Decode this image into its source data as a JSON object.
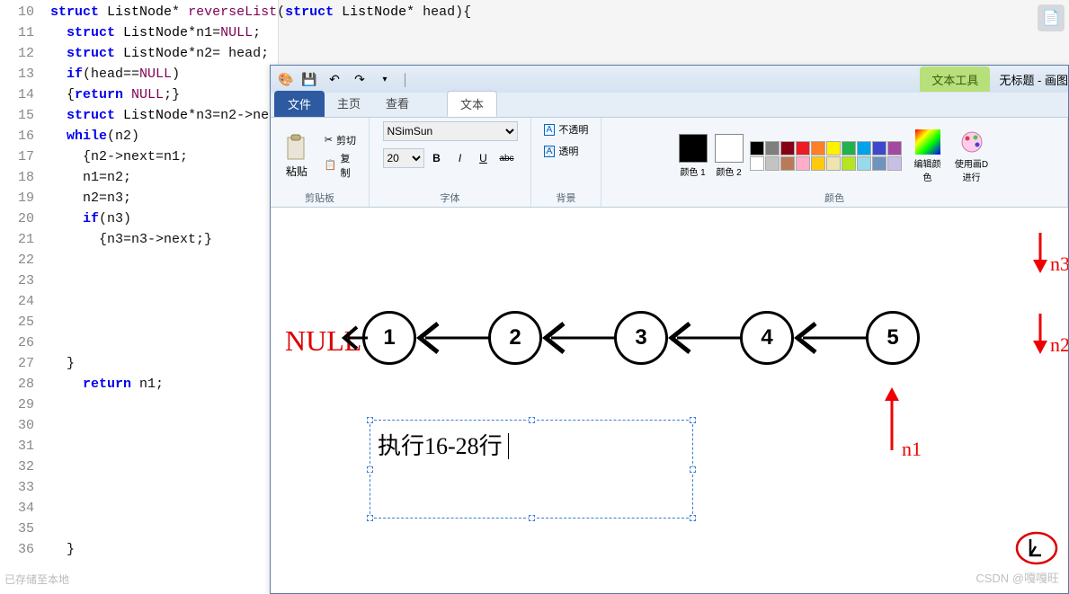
{
  "code": {
    "line_start": 10,
    "lines": [
      {
        "n": 10,
        "raw": "struct ListNode* reverseList(struct ListNode* head){"
      },
      {
        "n": 11,
        "raw": "  struct ListNode*n1=NULL;"
      },
      {
        "n": 12,
        "raw": "  struct ListNode*n2= head;"
      },
      {
        "n": 13,
        "raw": "  if(head==NULL)"
      },
      {
        "n": 14,
        "raw": "  {return NULL;}"
      },
      {
        "n": 15,
        "raw": "  struct ListNode*n3=n2->ne"
      },
      {
        "n": 16,
        "raw": "  while(n2)"
      },
      {
        "n": 17,
        "raw": "    {n2->next=n1;"
      },
      {
        "n": 18,
        "raw": "    n1=n2;"
      },
      {
        "n": 19,
        "raw": "    n2=n3;"
      },
      {
        "n": 20,
        "raw": "    if(n3)"
      },
      {
        "n": 21,
        "raw": "      {n3=n3->next;}"
      },
      {
        "n": 22,
        "raw": ""
      },
      {
        "n": 23,
        "raw": ""
      },
      {
        "n": 24,
        "raw": ""
      },
      {
        "n": 25,
        "raw": ""
      },
      {
        "n": 26,
        "raw": ""
      },
      {
        "n": 27,
        "raw": "  }"
      },
      {
        "n": 28,
        "raw": "    return n1;"
      },
      {
        "n": 29,
        "raw": ""
      },
      {
        "n": 30,
        "raw": ""
      },
      {
        "n": 31,
        "raw": ""
      },
      {
        "n": 32,
        "raw": ""
      },
      {
        "n": 33,
        "raw": ""
      },
      {
        "n": 34,
        "raw": ""
      },
      {
        "n": 35,
        "raw": ""
      },
      {
        "n": 36,
        "raw": "  }"
      }
    ],
    "status_text": "已存储至本地"
  },
  "paint": {
    "title": "无标题 - 画图",
    "context_tab": "文本工具",
    "tabs": {
      "file": "文件",
      "home": "主页",
      "view": "查看",
      "text": "文本"
    },
    "clipboard": {
      "label": "剪贴板",
      "paste": "粘贴",
      "cut": "剪切",
      "copy": "复制"
    },
    "font": {
      "label": "字体",
      "family": "NSimSun",
      "size": "20",
      "bold": "B",
      "italic": "I",
      "underline": "U",
      "strike": "abc"
    },
    "background": {
      "label": "背景",
      "opaque": "不透明",
      "transparent": "透明"
    },
    "colors": {
      "label": "颜色",
      "color1": "颜色 1",
      "color2": "颜色 2",
      "edit": "编辑颜色",
      "use": "使用画D 进行"
    },
    "palette": [
      "#000000",
      "#7f7f7f",
      "#880015",
      "#ed1c24",
      "#ff7f27",
      "#fff200",
      "#22b14c",
      "#00a2e8",
      "#3f48cc",
      "#a349a4",
      "#ffffff",
      "#c3c3c3",
      "#b97a57",
      "#ffaec9",
      "#ffc90e",
      "#efe4b0",
      "#b5e61d",
      "#99d9ea",
      "#7092be",
      "#c8bfe7"
    ]
  },
  "chart_data": {
    "type": "diagram",
    "description": "Reversed linked list after executing lines 16-28",
    "null_label": "NULL",
    "nodes": [
      1,
      2,
      3,
      4,
      5
    ],
    "direction": "all next-pointers point left (toward NULL)",
    "pointers": {
      "n1": "node 5",
      "n2": "past end / NULL",
      "n3": "past end / NULL"
    },
    "caption": "执行16-28行"
  },
  "watermark": "CSDN @嘎嘎旺"
}
